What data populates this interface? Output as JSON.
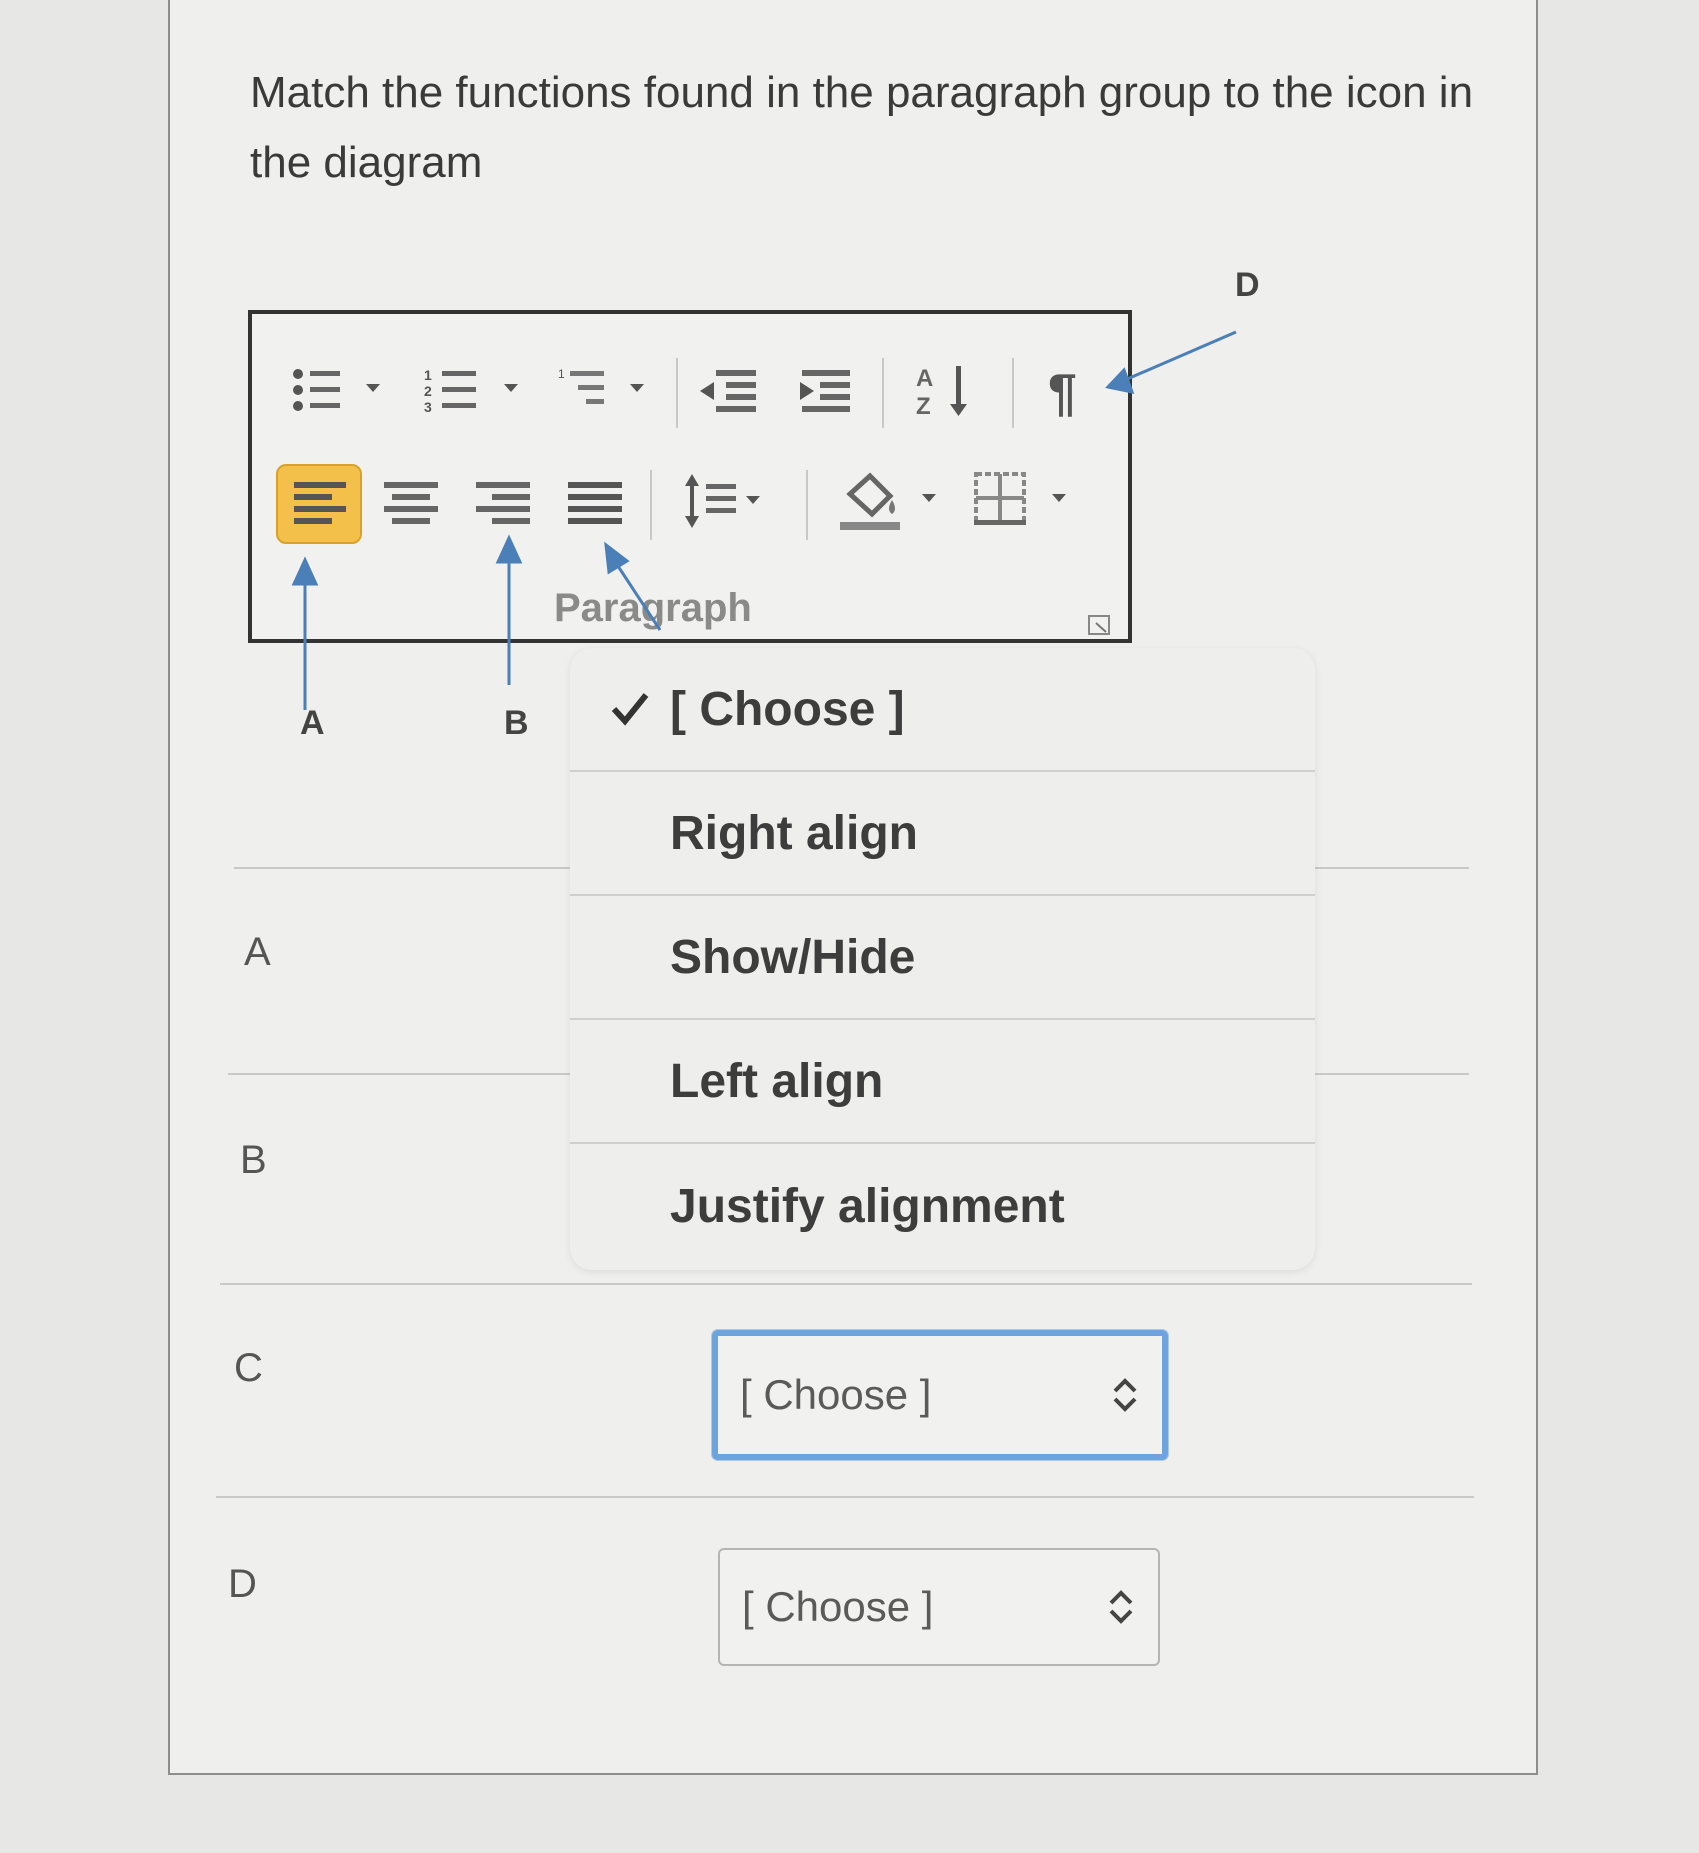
{
  "question": {
    "text": "Match the functions found in the paragraph group to the icon in the diagram"
  },
  "diagram": {
    "group_label": "Paragraph",
    "pointer_labels": {
      "a": "A",
      "b": "B",
      "d": "D"
    },
    "icons": [
      "bullets-icon",
      "numbering-icon",
      "multilevel-list-icon",
      "decrease-indent-icon",
      "increase-indent-icon",
      "sort-icon",
      "show-hide-icon",
      "align-left-icon",
      "center-icon",
      "align-right-icon",
      "justify-icon",
      "line-spacing-icon",
      "shading-icon",
      "borders-icon",
      "dialog-launcher-icon"
    ]
  },
  "rows": [
    {
      "label": "A"
    },
    {
      "label": "B"
    },
    {
      "label": "C",
      "select_value": "[ Choose ]"
    },
    {
      "label": "D",
      "select_value": "[ Choose ]"
    }
  ],
  "dropdown": {
    "options": [
      {
        "label": "[ Choose ]",
        "selected": true
      },
      {
        "label": "Right align"
      },
      {
        "label": "Show/Hide"
      },
      {
        "label": "Left align"
      },
      {
        "label": "Justify alignment"
      }
    ]
  },
  "colors": {
    "focus_ring": "#6ea4de",
    "pointer_arrow": "#4a7fb8",
    "highlight": "#f3c14a"
  }
}
